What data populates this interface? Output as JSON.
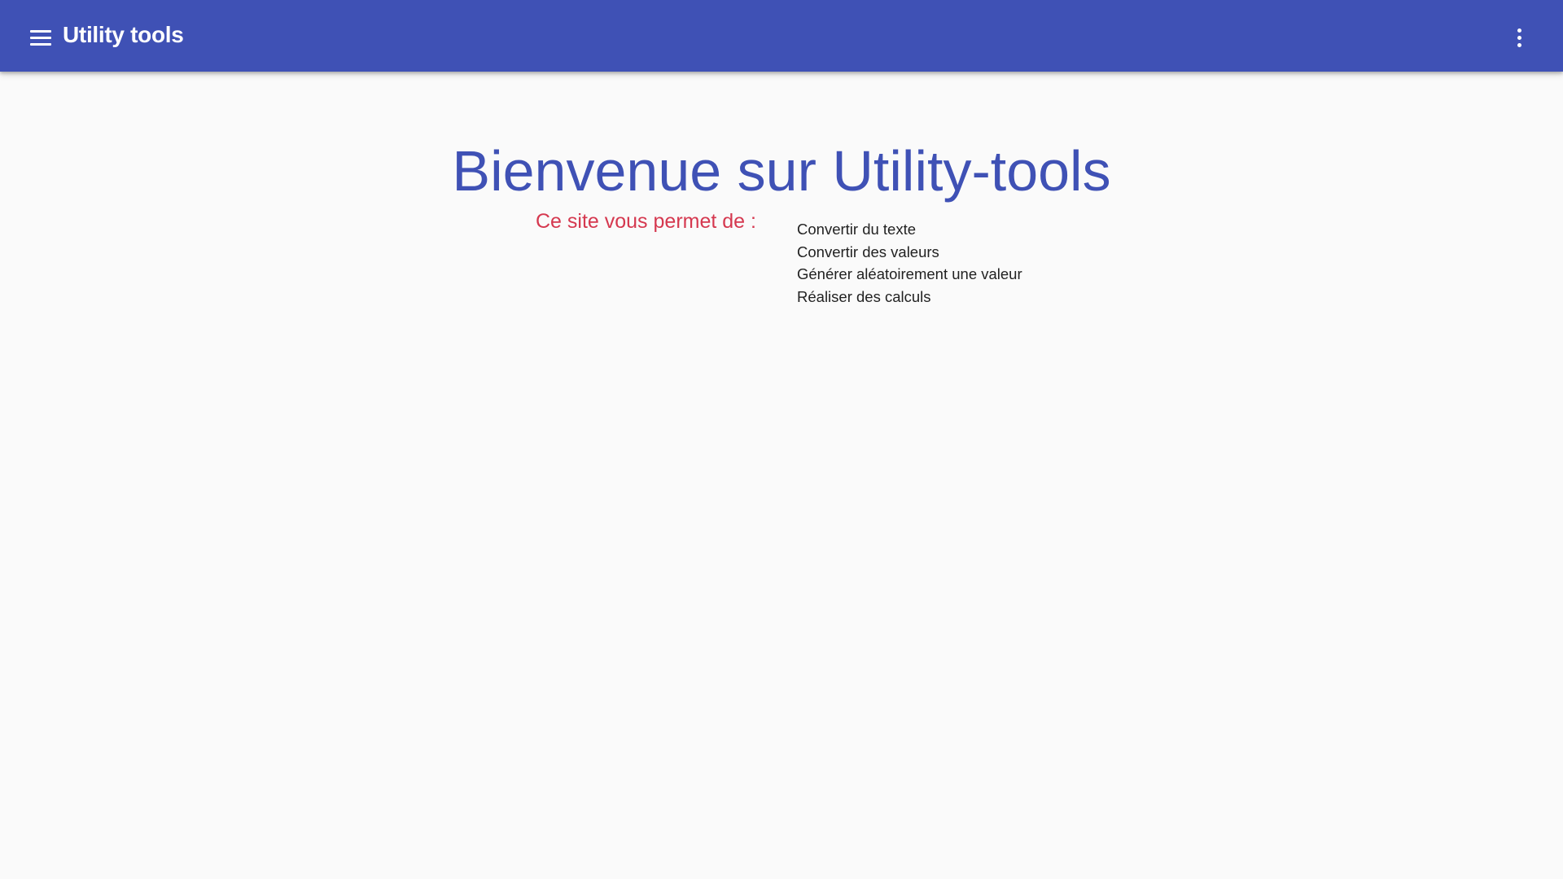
{
  "header": {
    "title": "Utility tools",
    "menu_icon": "menu-icon",
    "more_icon": "more-vert-icon",
    "background_color": "#3f51b5"
  },
  "main": {
    "heading": "Bienvenue sur Utility-tools",
    "heading_color": "#3f51b5",
    "subtitle": "Ce site vous permet de :",
    "subtitle_color": "#d5384f",
    "features": [
      "Convertir du texte",
      "Convertir des valeurs",
      "Générer aléatoirement une valeur",
      "Réaliser des calculs"
    ]
  }
}
